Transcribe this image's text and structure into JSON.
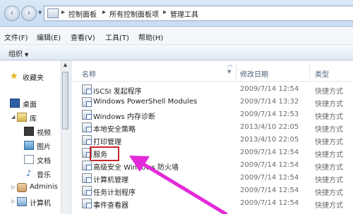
{
  "address": {
    "breadcrumbs": [
      "控制面板",
      "所有控制面板项",
      "管理工具"
    ]
  },
  "menu": [
    "文件(F)",
    "编辑(E)",
    "查看(V)",
    "工具(T)",
    "帮助(H)"
  ],
  "toolbar": {
    "organize_label": "组织"
  },
  "nav": {
    "favorites": "收藏夹",
    "desktop": "桌面",
    "library": "库",
    "video": "视频",
    "pictures": "图片",
    "documents": "文档",
    "music": "音乐",
    "user": "Adminis",
    "computer": "计算机"
  },
  "columns": {
    "name": "名称",
    "date": "修改日期",
    "type": "类型"
  },
  "rows": [
    {
      "name": "iSCSI 发起程序",
      "date": "2009/7/14 12:54",
      "type": "快捷方式"
    },
    {
      "name": "Windows PowerShell Modules",
      "date": "2009/7/14 13:32",
      "type": "快捷方式"
    },
    {
      "name": "Windows 内存诊断",
      "date": "2009/7/14 12:53",
      "type": "快捷方式"
    },
    {
      "name": "本地安全策略",
      "date": "2013/4/10 22:05",
      "type": "快捷方式"
    },
    {
      "name": "打印管理",
      "date": "2013/4/10 22:05",
      "type": "快捷方式"
    },
    {
      "name": "服务",
      "date": "2009/7/14 12:54",
      "type": "快捷方式"
    },
    {
      "name": "高级安全 Windows 防火墙",
      "date": "2009/7/14 12:54",
      "type": "快捷方式"
    },
    {
      "name": "计算机管理",
      "date": "2009/7/14 12:54",
      "type": "快捷方式"
    },
    {
      "name": "任务计划程序",
      "date": "2009/7/14 12:54",
      "type": "快捷方式"
    },
    {
      "name": "事件查看器",
      "date": "2009/7/14 12:54",
      "type": "快捷方式"
    }
  ],
  "annotation_color": "#e22ad8",
  "highlight_color": "#c8262b"
}
